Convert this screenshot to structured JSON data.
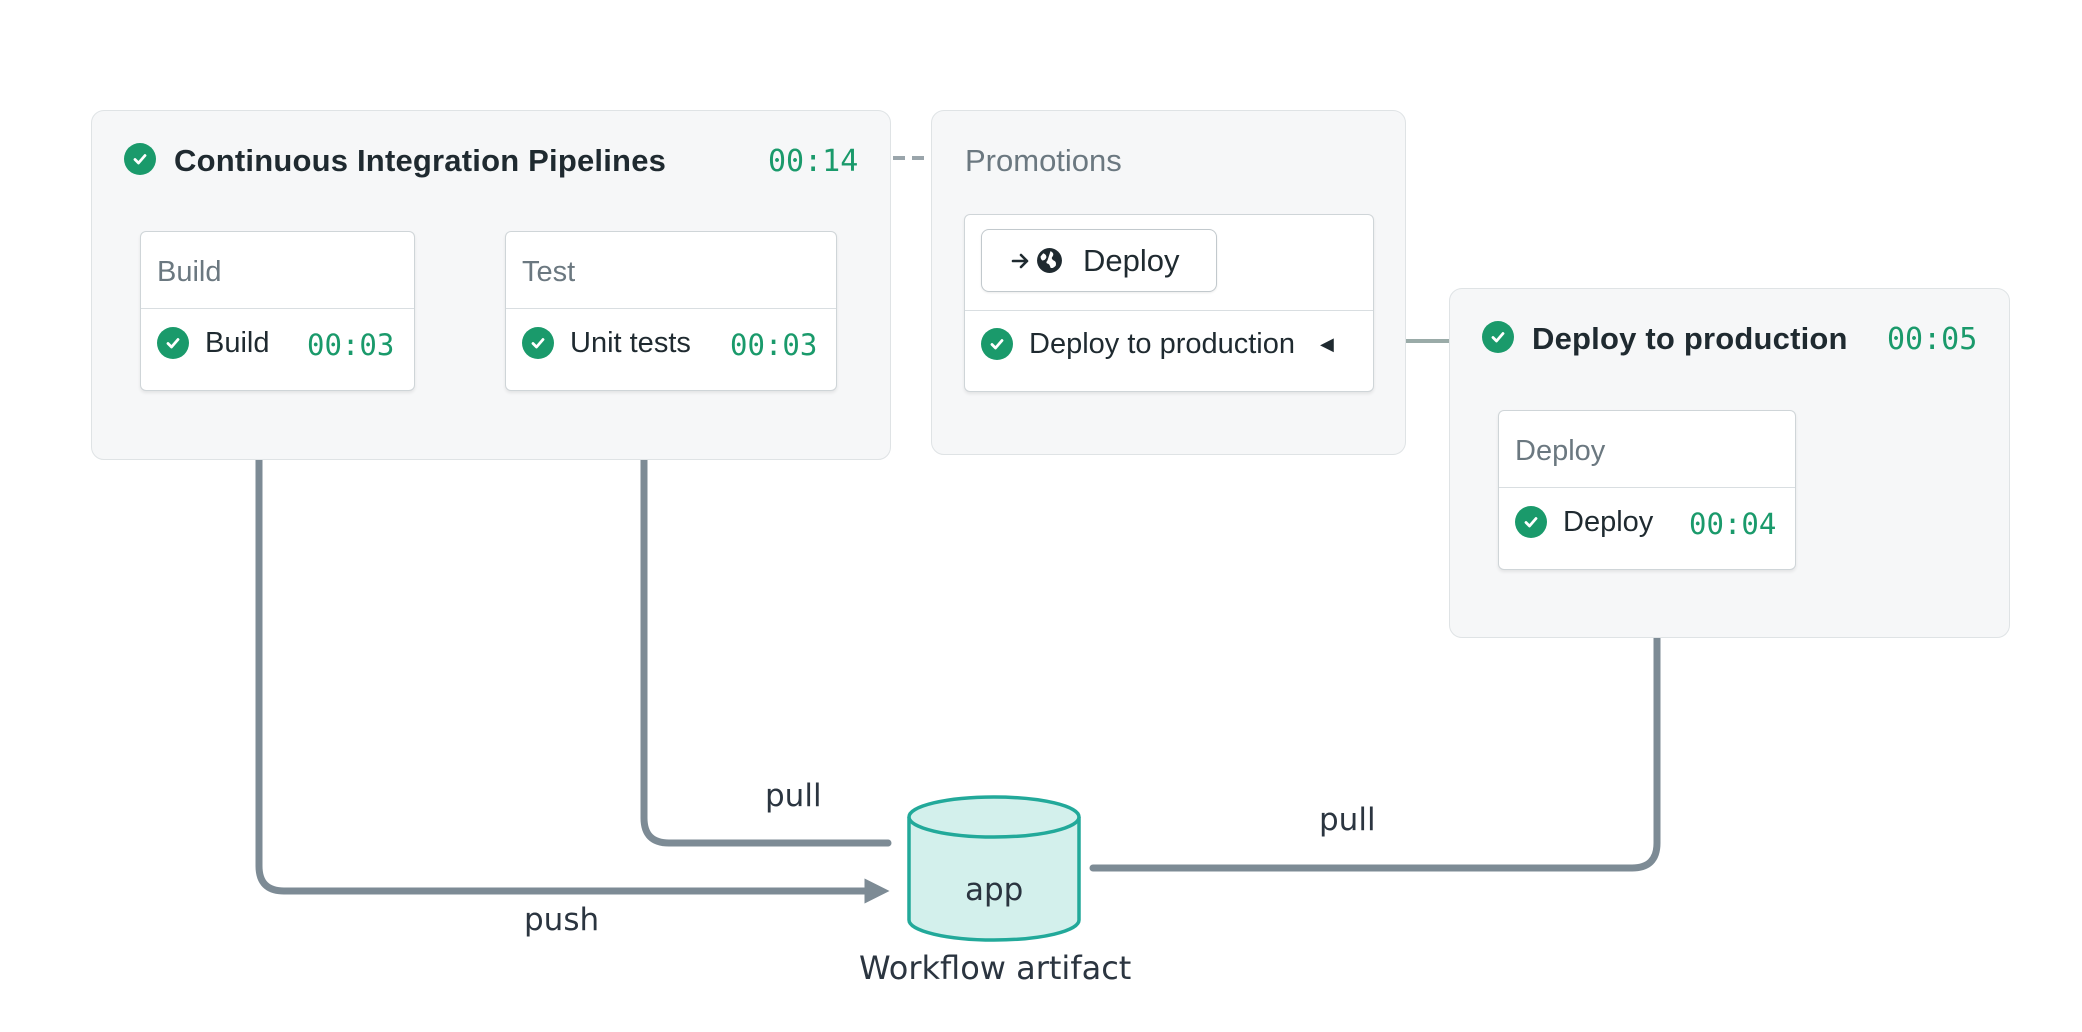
{
  "ci": {
    "title": "Continuous Integration Pipelines",
    "time": "00:14",
    "blocks": [
      {
        "header": "Build",
        "job": "Build",
        "time": "00:03"
      },
      {
        "header": "Test",
        "job": "Unit tests",
        "time": "00:03"
      }
    ]
  },
  "promotions": {
    "title": "Promotions",
    "button_label": "Deploy",
    "item_label": "Deploy to production",
    "item_caret": "◀"
  },
  "deploy": {
    "title": "Deploy to production",
    "time": "00:05",
    "block": {
      "header": "Deploy",
      "job": "Deploy",
      "time": "00:04"
    }
  },
  "artifact": {
    "name": "app",
    "caption": "Workflow artifact"
  },
  "edges": {
    "push": "push",
    "pull_test": "pull",
    "pull_deploy": "pull"
  },
  "colors": {
    "success": "#1a9a6b",
    "arrow": "#7d8b95",
    "artifact_fill": "#d3f0ec",
    "artifact_stroke": "#22a99a"
  },
  "icons": {
    "status": "check-circle-icon",
    "promote": "arrow-right-icon",
    "environment": "globe-icon",
    "caret": "caret-left-icon"
  }
}
